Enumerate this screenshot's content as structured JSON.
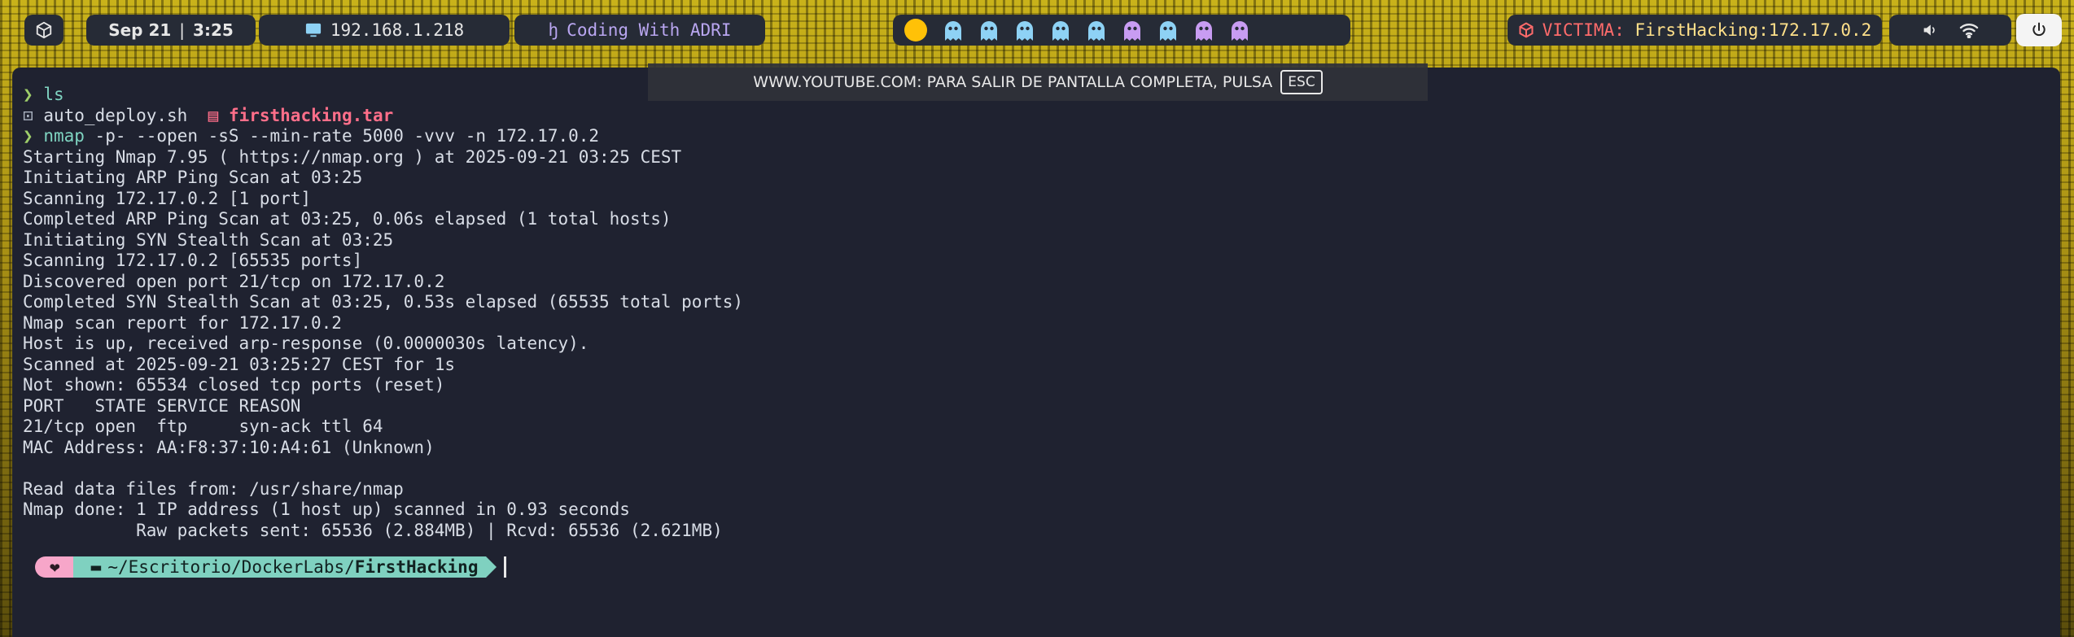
{
  "topbar": {
    "date": "Sep 21",
    "time": "3:25",
    "ip": "192.168.1.218",
    "channel": "Coding With ADRI",
    "victim_label": "VICTIMA:",
    "victim_value": "FirstHacking:172.17.0.2"
  },
  "banner": {
    "text": "WWW.YOUTUBE.COM: PARA SALIR DE PANTALLA COMPLETA, PULSA",
    "key": "ESC"
  },
  "terminal": {
    "prompt_symbol": "❯",
    "cmd1": "ls",
    "file1": "auto_deploy.sh",
    "file2": "firsthacking.tar",
    "cmd2_name": "nmap",
    "cmd2_args": "-p- --open -sS --min-rate 5000 -vvv -n 172.17.0.2",
    "output": "Starting Nmap 7.95 ( https://nmap.org ) at 2025-09-21 03:25 CEST\nInitiating ARP Ping Scan at 03:25\nScanning 172.17.0.2 [1 port]\nCompleted ARP Ping Scan at 03:25, 0.06s elapsed (1 total hosts)\nInitiating SYN Stealth Scan at 03:25\nScanning 172.17.0.2 [65535 ports]\nDiscovered open port 21/tcp on 172.17.0.2\nCompleted SYN Stealth Scan at 03:25, 0.53s elapsed (65535 total ports)\nNmap scan report for 172.17.0.2\nHost is up, received arp-response (0.0000030s latency).\nScanned at 2025-09-21 03:25:27 CEST for 1s\nNot shown: 65534 closed tcp ports (reset)\nPORT   STATE SERVICE REASON\n21/tcp open  ftp     syn-ack ttl 64\nMAC Address: AA:F8:37:10:A4:61 (Unknown)\n\nRead data files from: /usr/share/nmap\nNmap done: 1 IP address (1 host up) scanned in 0.93 seconds\n           Raw packets sent: 65536 (2.884MB) | Rcvd: 65536 (2.621MB)",
    "ps1_heart": "❤",
    "ps1_path_prefix": "~/Escritorio/DockerLabs/",
    "ps1_path_dir": "FirstHacking"
  },
  "colors": {
    "accent_yellow": "#ffc107",
    "ghost_blue": "#8ed2f5",
    "ghost_purple": "#c89cf2",
    "victim_red": "#ff6b6b"
  },
  "icons": [
    "cube-icon",
    "monitor-icon",
    "code-icon",
    "pacman-icon",
    "ghost-icon",
    "target-icon",
    "volume-icon",
    "wifi-icon",
    "power-icon"
  ]
}
